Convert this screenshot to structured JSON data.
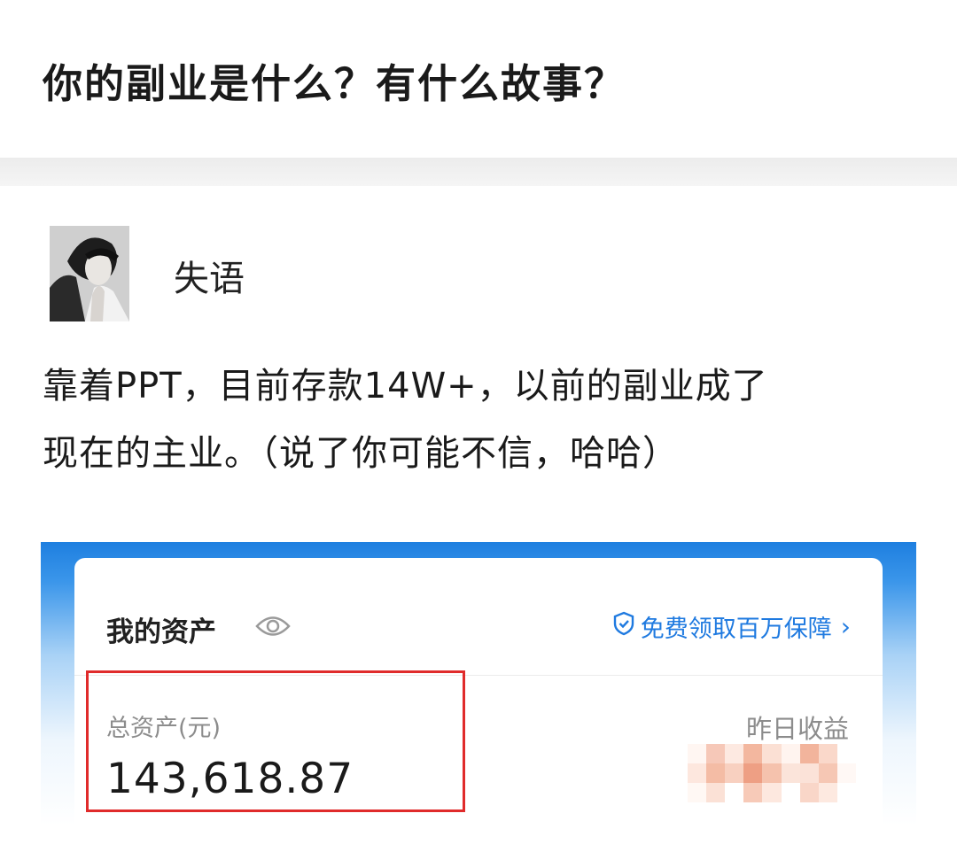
{
  "question": {
    "title": "你的副业是什么？有什么故事？"
  },
  "author": {
    "name": "失语",
    "avatar_icon": "avatar-image"
  },
  "answer": {
    "lines": [
      "靠着PPT，目前存款14W+，以前的副业成了",
      "现在的主业。（说了你可能不信，哈哈）"
    ]
  },
  "screenshot": {
    "card_title": "我的资产",
    "visibility_icon": "eye-icon",
    "guarantee_icon": "shield-icon",
    "guarantee_link": "免费领取百万保障",
    "guarantee_chevron": "›",
    "total_assets_label": "总资产(元)",
    "total_assets_value": "143,618.87",
    "yesterday_earnings_label": "昨日收益",
    "colors": {
      "accent_blue": "#1f7ae0",
      "highlight_red": "#e02b2b"
    }
  }
}
